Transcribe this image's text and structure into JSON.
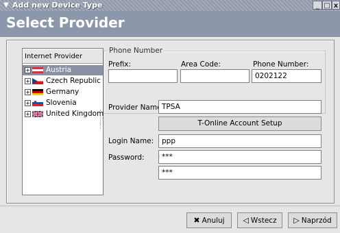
{
  "window": {
    "title": "Add new Device Type",
    "controls": [
      "_",
      "□",
      "x"
    ]
  },
  "header": {
    "title": "Select Provider"
  },
  "tree": {
    "header": "Internet Provider",
    "items": [
      {
        "label": "Austria",
        "flag": "austria-flag-icon",
        "selected": true
      },
      {
        "label": "Czech Republic",
        "flag": "czech-flag-icon",
        "selected": false
      },
      {
        "label": "Germany",
        "flag": "germany-flag-icon",
        "selected": false
      },
      {
        "label": "Slovenia",
        "flag": "slovenia-flag-icon",
        "selected": false
      },
      {
        "label": "United Kingdom",
        "flag": "uk-flag-icon",
        "selected": false
      }
    ]
  },
  "phone": {
    "legend": "Phone Number",
    "prefix_label": "Prefix:",
    "prefix_value": "",
    "area_label": "Area Code:",
    "area_value": "",
    "number_label": "Phone Number:",
    "number_value": "0202122"
  },
  "form": {
    "provider_label": "Provider Name:",
    "provider_value": "TPSA",
    "setup_button": "T-Online Account Setup",
    "login_label": "Login Name:",
    "login_value": "ppp",
    "password_label": "Password:",
    "password_value": "***",
    "password_confirm_value": "***"
  },
  "buttons": {
    "cancel": "Anuluj",
    "back": "Wstecz",
    "next": "Naprzód"
  },
  "colors": {
    "header_bg": "#8d97ab",
    "selection_bg": "#8992a4"
  }
}
